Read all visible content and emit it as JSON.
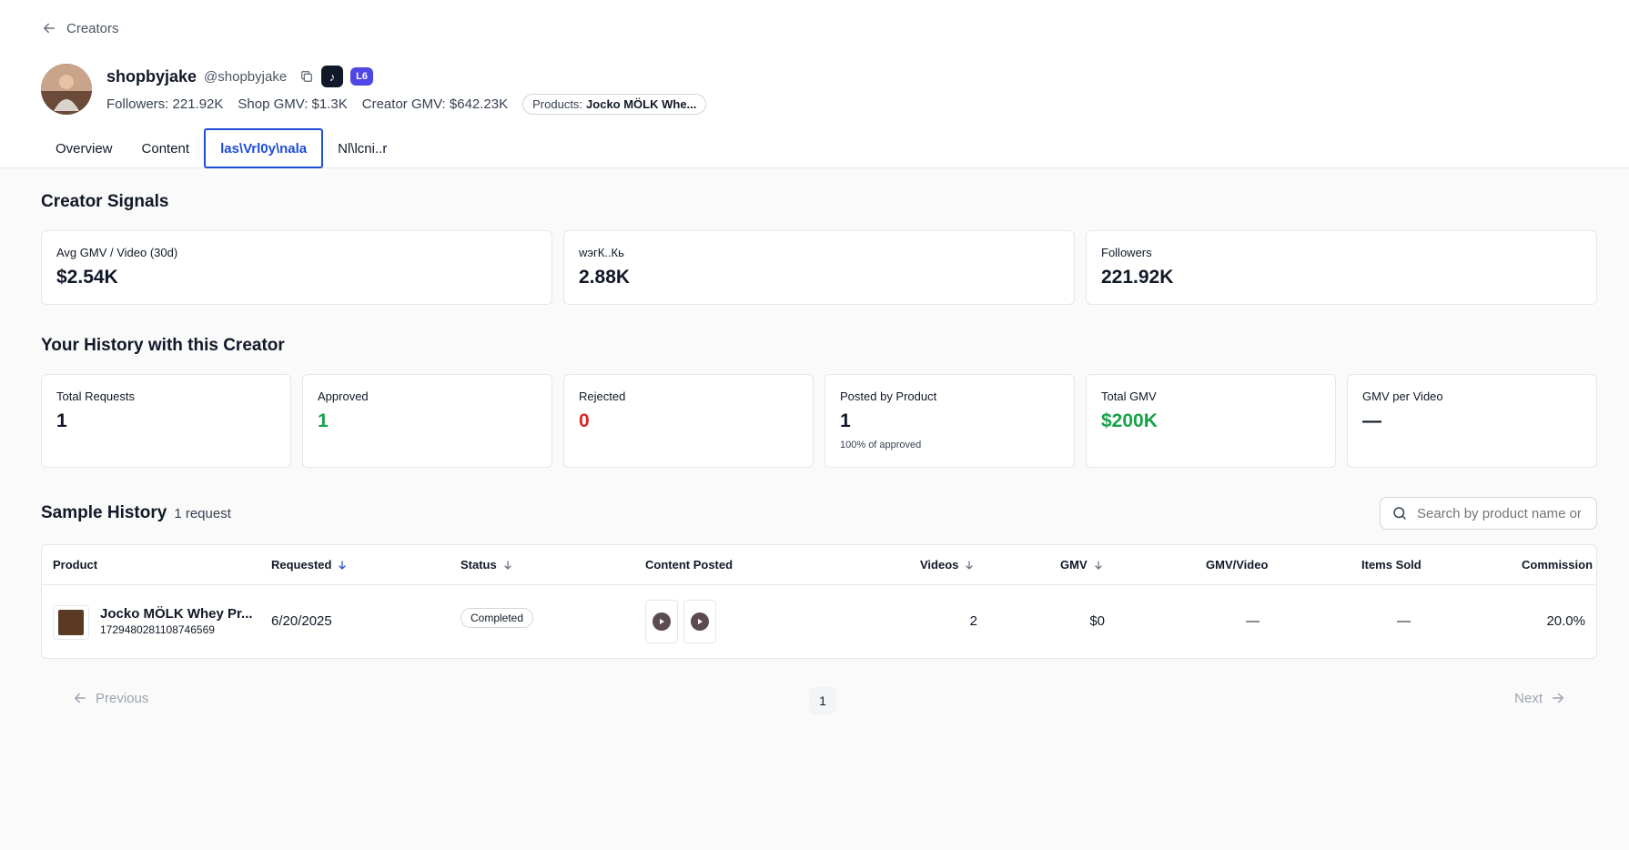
{
  "nav": {
    "back_label": "Creators"
  },
  "creator": {
    "name": "shopbyjake",
    "handle": "@shopbyjake",
    "level_badge": "L6",
    "followers_text": "Followers: 221.92K",
    "shop_gmv_text": "Shop GMV: $1.3K",
    "creator_gmv_text": "Creator GMV: $642.23K",
    "products_label": "Products:",
    "products_value": "Jocko MÖLK Whe..."
  },
  "tabs": [
    {
      "label": "Overview"
    },
    {
      "label": "Content"
    },
    {
      "label": "las\\Vrl0y\\nalа"
    },
    {
      "label": "Nl\\lcni..r"
    }
  ],
  "signals": {
    "title": "Creator Signals",
    "cards": [
      {
        "label": "Avg GMV / Video (30d)",
        "value": "$2.54K"
      },
      {
        "label": "wэгК..Кь",
        "value": "2.88K"
      },
      {
        "label": "Followers",
        "value": "221.92K"
      }
    ]
  },
  "history": {
    "title": "Your History with this Creator",
    "cards": [
      {
        "label": "Total Requests",
        "value": "1"
      },
      {
        "label": "Approved",
        "value": "1"
      },
      {
        "label": "Rejected",
        "value": "0"
      },
      {
        "label": "Posted by Product",
        "value": "1",
        "sub": "100% of approved"
      },
      {
        "label": "Total GMV",
        "value": "$200K"
      },
      {
        "label": "GMV per Video",
        "value": "—"
      }
    ]
  },
  "samples": {
    "title": "Sample History",
    "count": "1 request",
    "search_placeholder": "Search by product name or",
    "columns": {
      "product": "Product",
      "requested": "Requested",
      "status": "Status",
      "content": "Content Posted",
      "videos": "Videos",
      "gmv": "GMV",
      "gmv_video": "GMV/Video",
      "items_sold": "Items Sold",
      "commission": "Commission"
    },
    "rows": [
      {
        "product_name": "Jocko MÖLK Whey Pr...",
        "product_id": "1729480281108746569",
        "requested": "6/20/2025",
        "status": "Completed",
        "videos": "2",
        "gmv": "$0",
        "gmv_video": "—",
        "items_sold": "—",
        "commission": "20.0%"
      }
    ]
  },
  "pagination": {
    "prev": "Previous",
    "page": "1",
    "next": "Next"
  },
  "colors": {
    "accent": "#1d4ed8",
    "positive": "#16a34a",
    "negative": "#dc2626",
    "level_badge": "#4f46e5"
  }
}
